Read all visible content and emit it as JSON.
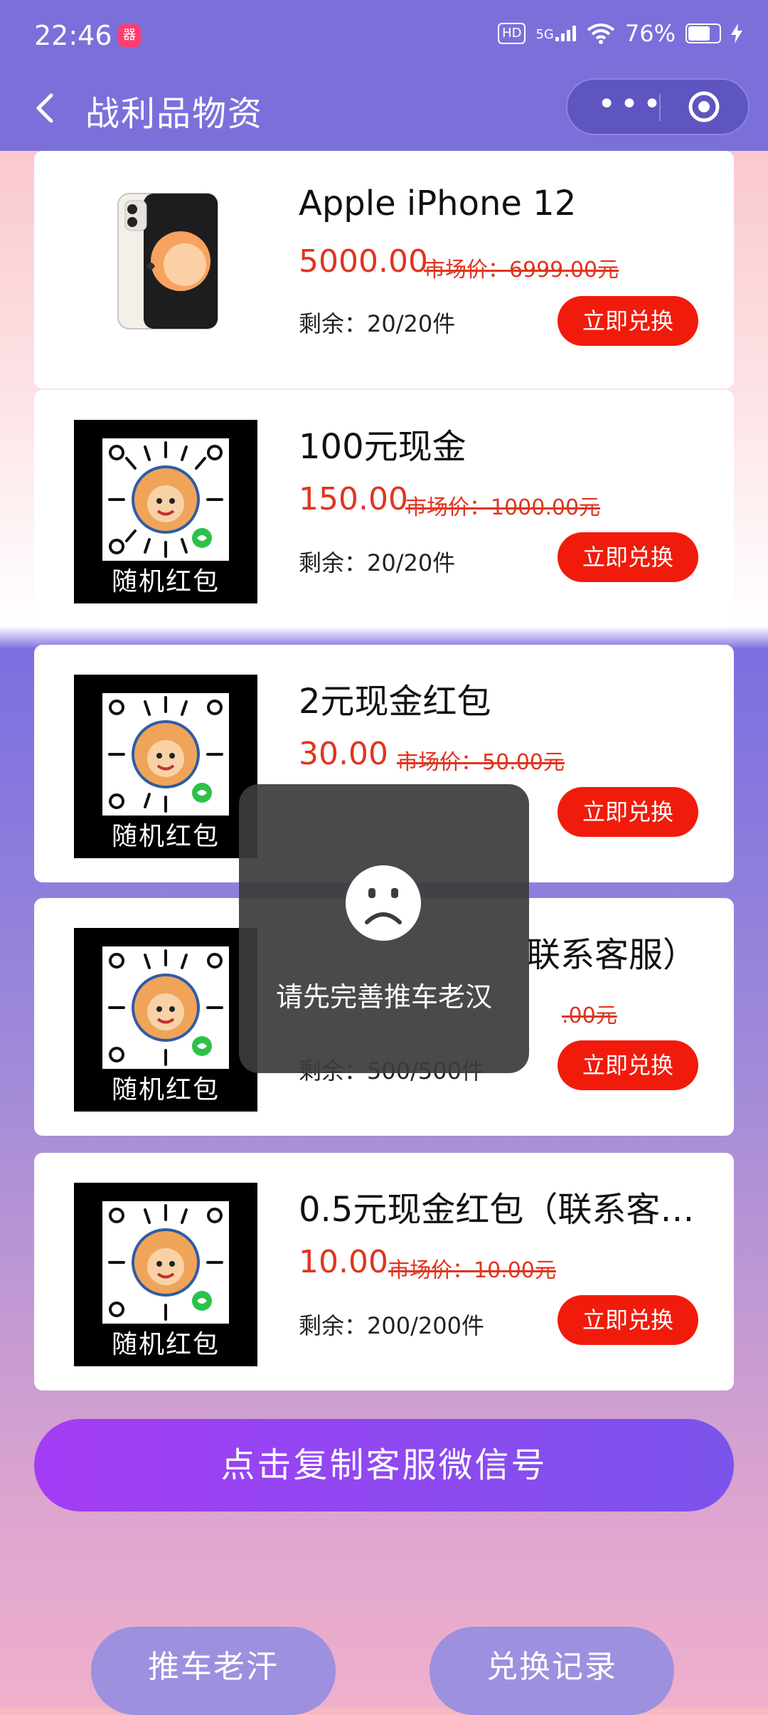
{
  "status_bar": {
    "time": "22:46",
    "app_badge": "器",
    "hd": "HD",
    "network": "5G",
    "battery": "76%"
  },
  "nav": {
    "title": "战利品物资",
    "more": "•••"
  },
  "products": [
    {
      "title": "Apple iPhone 12",
      "price": "5000.00",
      "market_price": "市场价：6999.00元",
      "stock": "剩余：20/20件",
      "button": "立即兑换"
    },
    {
      "title": "100元现金",
      "price": "150.00",
      "market_price": "市场价：1000.00元",
      "stock": "剩余：20/20件",
      "button": "立即兑换",
      "image_caption": "随机红包"
    },
    {
      "title": "2元现金红包",
      "price": "30.00",
      "market_price": "市场价：50.00元",
      "stock": "",
      "button": "立即兑换",
      "image_caption": "随机红包"
    },
    {
      "title": "联系客服）",
      "price": "",
      "market_price": ".00元",
      "stock": "剩余：500/500件",
      "button": "立即兑换",
      "image_caption": "随机红包"
    },
    {
      "title": "0.5元现金红包（联系客…",
      "price": "10.00",
      "market_price": "市场价：10.00元",
      "stock": "剩余：200/200件",
      "button": "立即兑换",
      "image_caption": "随机红包"
    }
  ],
  "copy_button": "点击复制客服微信号",
  "bottom_buttons": [
    "推车老汗",
    "兑换记录"
  ],
  "toast": {
    "message": "请先完善推车老汉",
    "icon": "sad-face-icon"
  }
}
